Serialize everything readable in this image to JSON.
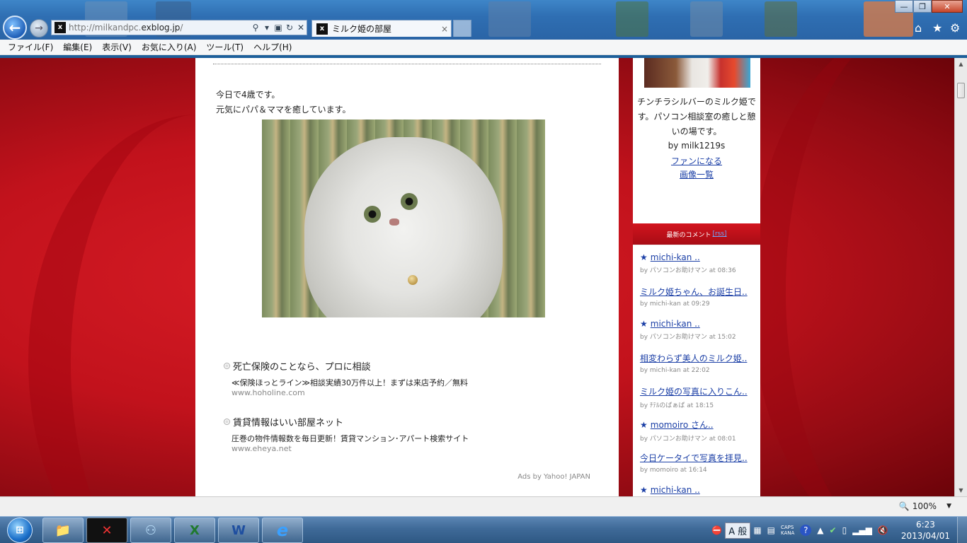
{
  "browser": {
    "address_url_prefix": "http://milkandpc.",
    "address_url_domain": "exblog.jp",
    "address_url_suffix": "/",
    "tab_title": "ミルク姫の部屋",
    "tab_close": "×",
    "favicon": "x",
    "back_glyph": "←",
    "forward_glyph": "→",
    "search_glyph": "⚲",
    "window_min": "—",
    "window_max": "❐",
    "window_close": "✕",
    "home_icon": "⌂",
    "star_icon": "★",
    "gear_icon": "⚙"
  },
  "menu": [
    "ファイル(F)",
    "編集(E)",
    "表示(V)",
    "お気に入り(A)",
    "ツール(T)",
    "ヘルプ(H)"
  ],
  "post": {
    "line1": "今日で4歳です。",
    "line2": "元気にパパ＆ママを癒しています。"
  },
  "ads": [
    {
      "title": "死亡保険のことなら、プロに相談",
      "desc": "≪保険ほっとライン≫相談実績30万件以上！まずは来店予約／無料",
      "url": "www.hoholine.com"
    },
    {
      "title": "賃貸情報はいい部屋ネット",
      "desc": "圧巻の物件情報数を毎日更新！賃貸マンション･アパート検索サイト",
      "url": "www.eheya.net"
    }
  ],
  "ads_by": "Ads by Yahoo! JAPAN",
  "profile": {
    "desc": "チンチラシルバーのミルク姫です。パソコン相談室の癒しと憩いの場です。",
    "by": "by milk1219s",
    "fan_link": "ファンになる",
    "images_link": "画像一覧"
  },
  "comments_header": {
    "title": "最新のコメント",
    "rss": "[rss]"
  },
  "comments": [
    {
      "title": "michi-kan ..",
      "star": true,
      "meta": "by パソコンお助けマン at 08:36"
    },
    {
      "title": "ミルク姫ちゃん、お誕生日..",
      "star": false,
      "meta": "by michi-kan at 09:29"
    },
    {
      "title": "michi-kan ..",
      "star": true,
      "meta": "by パソコンお助けマン at 15:02"
    },
    {
      "title": "相変わらず美人のミルク姫..",
      "star": false,
      "meta": "by michi-kan at 22:02"
    },
    {
      "title": "ミルク姫の写真に入りこん..",
      "star": false,
      "meta": "by ﾁﾃﾙのばぁば at 18:15"
    },
    {
      "title": "momoiro さん..",
      "star": true,
      "meta": "by パソコンお助けマン at 08:01"
    },
    {
      "title": "今日ケータイで写真を拝見..",
      "star": false,
      "meta": "by momoiro at 16:14"
    },
    {
      "title": "michi-kan ..",
      "star": true,
      "meta": ""
    }
  ],
  "statusbar": {
    "zoom": "100%",
    "zoom_icon": "🔍",
    "dropdown": "▼"
  },
  "taskbar": {
    "start": "⊞",
    "items": [
      {
        "name": "explorer",
        "glyph": "📁"
      },
      {
        "name": "app-x",
        "glyph": "✕"
      },
      {
        "name": "network",
        "glyph": "⚇"
      },
      {
        "name": "excel",
        "glyph": "X"
      },
      {
        "name": "word",
        "glyph": "W"
      },
      {
        "name": "ie",
        "glyph": "e"
      }
    ],
    "ime_mode": "A 般",
    "caps": "CAPS",
    "kana": "KANA",
    "help": "?",
    "time": "6:23",
    "date": "2013/04/01"
  },
  "colors": {
    "page_bg": "#c2121c",
    "link": "#1b3fa6",
    "header_red": "#d2141e",
    "taskbar": "#3f6a98"
  }
}
